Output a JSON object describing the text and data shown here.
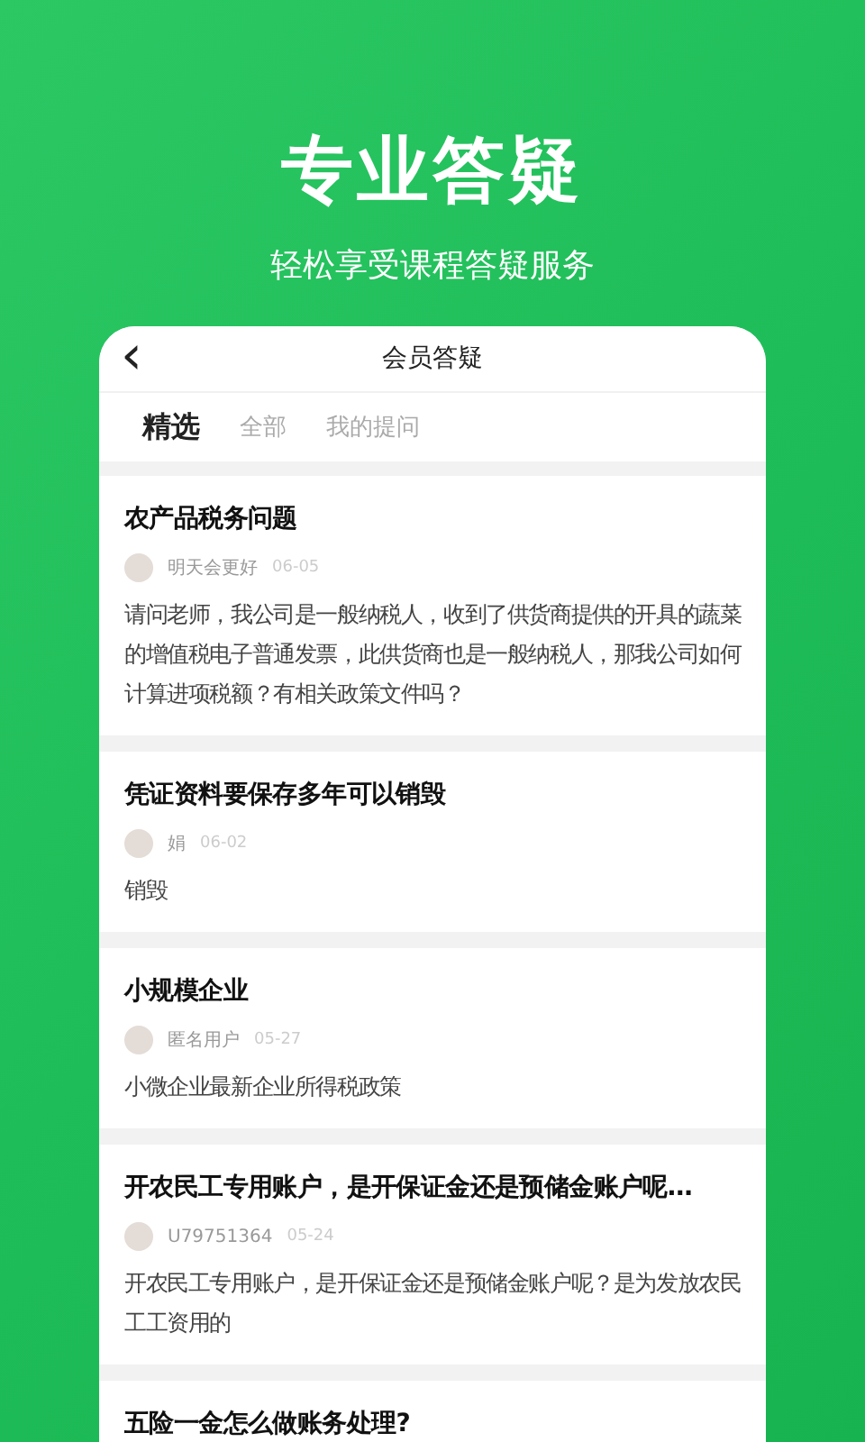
{
  "headline": "专业答疑",
  "subtitle": "轻松享受课程答疑服务",
  "screen": {
    "back_icon": "‹",
    "title": "会员答疑",
    "tabs": [
      {
        "label": "精选",
        "selected": true
      },
      {
        "label": "全部",
        "selected": false
      },
      {
        "label": "我的提问",
        "selected": false
      }
    ],
    "questions": [
      {
        "title": "农产品税务问题",
        "user": "明天会更好",
        "date": "06-05",
        "body": "请问老师，我公司是一般纳税人，收到了供货商提供的开具的蔬菜的增值税电子普通发票，此供货商也是一般纳税人，那我公司如何计算进项税额？有相关政策文件吗？"
      },
      {
        "title": "凭证资料要保存多年可以销毁",
        "user": "娟",
        "date": "06-02",
        "body": "销毁"
      },
      {
        "title": "小规模企业",
        "user": "匿名用户",
        "date": "05-27",
        "body": "小微企业最新企业所得税政策"
      },
      {
        "title": "开农民工专用账户，是开保证金还是预储金账户呢…",
        "user": "U79751364",
        "date": "05-24",
        "body": "开农民工专用账户，是开保证金还是预储金账户呢？是为发放农民工工资用的"
      },
      {
        "title": "五险一金怎么做账务处理?"
      }
    ]
  }
}
